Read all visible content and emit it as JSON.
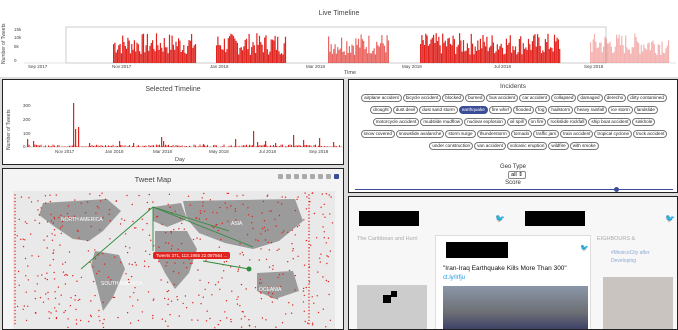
{
  "live_timeline": {
    "title": "Live Timeline",
    "ylabel": "Number of Tweets",
    "xlabel": "Time",
    "yticks": [
      "15k",
      "10k",
      "5k",
      "0"
    ],
    "xticks": [
      "Sep 2017",
      "Nov 2017",
      "Jan 2018",
      "Mar 2018",
      "May 2018",
      "Jul 2018",
      "Sep 2018"
    ]
  },
  "selected_timeline": {
    "title": "Selected Timeline",
    "ylabel": "Number of Tweets",
    "xlabel": "Day",
    "yticks": [
      "300",
      "200",
      "100",
      "0"
    ],
    "xticks": [
      "Nov 2017",
      "Jan 2018",
      "Mar 2018",
      "May 2018",
      "Jul 2018",
      "Sep 2018"
    ]
  },
  "tweet_map": {
    "title": "Tweet Map",
    "labels": [
      "NORTH AMERICA",
      "ASIA",
      "SOUTH AMERICA",
      "OCEANIA"
    ],
    "tooltip": "Tweets 371, 113.1955 22.087564 ...",
    "toolbar_icons": [
      "camera-icon",
      "pan-icon",
      "box-select-icon",
      "lasso-icon",
      "zoom-in-icon",
      "zoom-out-icon",
      "reset-icon",
      "home-icon"
    ]
  },
  "incidents": {
    "title": "Incidents",
    "tags": [
      "airplane accident",
      "bicycle accident",
      "blocked",
      "burned",
      "bus accident",
      "car accident",
      "collapsed",
      "damaged",
      "derecho",
      "dirty contamined",
      "drought",
      "dust devil",
      "dust sand storm",
      "earthquake",
      "fire whirl",
      "flooded",
      "fog",
      "hailstorm",
      "heavy rainfall",
      "ice storm",
      "landslide",
      "motorcycle accident",
      "mudslide mudflow",
      "nuclear explosion",
      "oil spill",
      "on fire",
      "rockslide rockfall",
      "ship boat accident",
      "sinkhole",
      "snow covered",
      "snowslide avalanche",
      "storm surge",
      "thunderstorm",
      "tornado",
      "traffic jam",
      "train accident",
      "tropical cyclone",
      "truck accident",
      "under construction",
      "van accident",
      "volcanic eruption",
      "wildfire",
      "with smoke"
    ],
    "selected": "earthquake",
    "geo_type_label": "Geo Type",
    "geo_type_value": "all",
    "score_label": "Score"
  },
  "tweets": {
    "bg_text_1": "The Caribbean and Hurri",
    "bg_text_2": "EIGHBOURS &",
    "bg_text_3": "#MexicoCity after",
    "bg_text_4": "Developing",
    "headline": "\"Iran-Iraq Earthquake Kills More Than 300\"",
    "link": "ct.ly/lrfju"
  },
  "colors": {
    "accent": "#e0231e",
    "selected_tag": "#3a4d96"
  }
}
